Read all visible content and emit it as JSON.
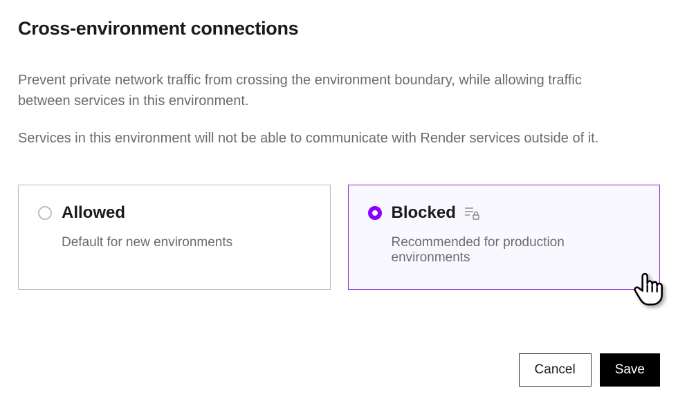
{
  "header": {
    "title": "Cross-environment connections"
  },
  "description": {
    "p1": "Prevent private network traffic from crossing the environment boundary, while allowing traffic between services in this environment.",
    "p2": "Services in this environment will not be able to communicate with Render services outside of it."
  },
  "options": {
    "allowed": {
      "title": "Allowed",
      "subtitle": "Default for new environments",
      "selected": false
    },
    "blocked": {
      "title": "Blocked",
      "subtitle": "Recommended for production environments",
      "selected": true
    }
  },
  "buttons": {
    "cancel": "Cancel",
    "save": "Save"
  },
  "colors": {
    "accent": "#8a00ff",
    "selected_border": "#8a2be2",
    "selected_bg": "#faf8ff"
  }
}
